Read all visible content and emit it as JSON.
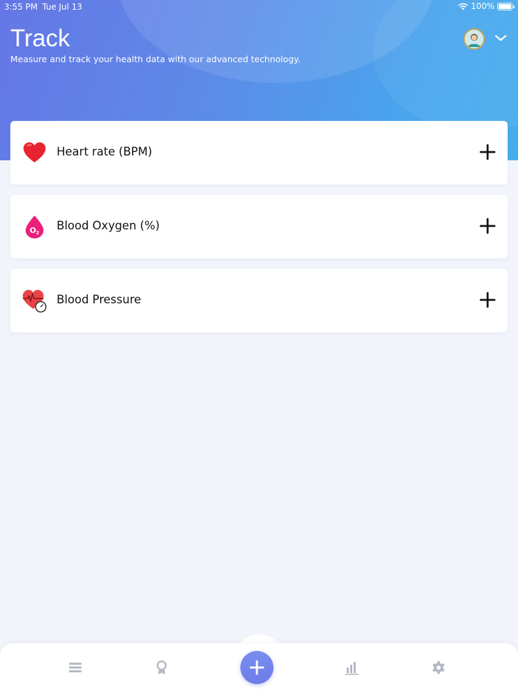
{
  "status_bar": {
    "time": "3:55 PM",
    "date": "Tue Jul 13",
    "battery": "100%",
    "icons": [
      "wifi-icon",
      "battery-icon"
    ]
  },
  "header": {
    "title": "Track",
    "subtitle": "Measure and track your health data with our advanced technology."
  },
  "cards": [
    {
      "label": "Heart rate (BPM)",
      "icon": "heart-icon"
    },
    {
      "label": "Blood Oxygen (%)",
      "icon": "blood-oxygen-drop-icon"
    },
    {
      "label": "Blood Pressure",
      "icon": "blood-pressure-icon"
    }
  ],
  "tab_bar": {
    "items": [
      "list-icon",
      "award-icon",
      "plus-icon",
      "bar-chart-icon",
      "gear-icon"
    ]
  },
  "colors": {
    "header_gradient_start": "#6576e6",
    "header_gradient_end": "#45aeed",
    "background": "#f2f4fc",
    "fab": "#7284ec",
    "tab_icon": "#b3b8c2",
    "heart": "#e8232f",
    "oxygen_drop": "#ec1f7a"
  }
}
